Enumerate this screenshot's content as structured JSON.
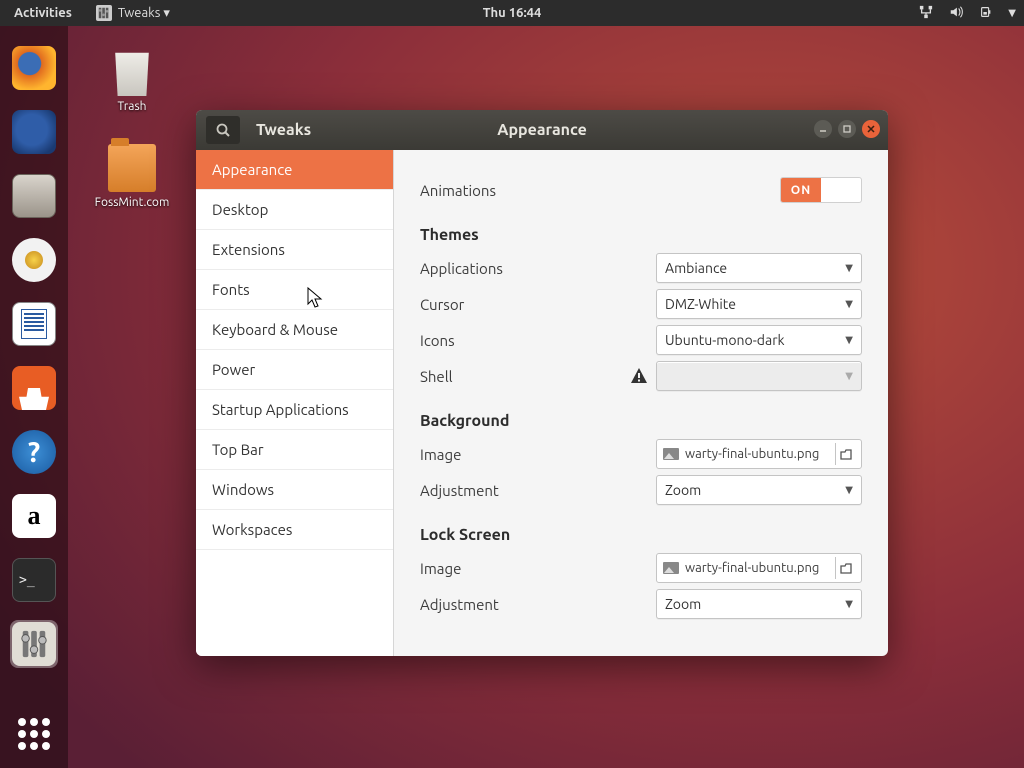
{
  "topbar": {
    "activities": "Activities",
    "app_menu": "Tweaks ▾",
    "clock": "Thu 16:44"
  },
  "desktop": {
    "trash": "Trash",
    "folder": "FossMint.com"
  },
  "window": {
    "title": "Tweaks",
    "subtitle": "Appearance"
  },
  "sidebar": {
    "items": [
      "Appearance",
      "Desktop",
      "Extensions",
      "Fonts",
      "Keyboard & Mouse",
      "Power",
      "Startup Applications",
      "Top Bar",
      "Windows",
      "Workspaces"
    ]
  },
  "panel": {
    "animations_label": "Animations",
    "toggle_on": "ON",
    "themes_heading": "Themes",
    "applications_label": "Applications",
    "applications_value": "Ambiance",
    "cursor_label": "Cursor",
    "cursor_value": "DMZ-White",
    "icons_label": "Icons",
    "icons_value": "Ubuntu-mono-dark",
    "shell_label": "Shell",
    "shell_value": "",
    "background_heading": "Background",
    "image_label": "Image",
    "bg_image_value": "warty-final-ubuntu.png",
    "adjustment_label": "Adjustment",
    "bg_adj_value": "Zoom",
    "lock_heading": "Lock Screen",
    "lock_image_value": "warty-final-ubuntu.png",
    "lock_adj_value": "Zoom"
  }
}
